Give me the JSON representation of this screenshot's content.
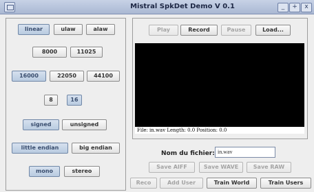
{
  "window": {
    "title": "Mistral SpkDet Demo V 0.1",
    "minimize": "_",
    "maximize": "+",
    "close": "x"
  },
  "options": {
    "encoding": [
      "linear",
      "ulaw",
      "alaw"
    ],
    "rate_a": [
      "8000",
      "11025"
    ],
    "rate_b": [
      "16000",
      "22050",
      "44100"
    ],
    "bits": [
      "8",
      "16"
    ],
    "sign": [
      "signed",
      "unsigned"
    ],
    "endian": [
      "little endian",
      "big endian"
    ],
    "channels": [
      "mono",
      "stereo"
    ]
  },
  "player": {
    "play": "Play",
    "record": "Record",
    "pause": "Pause",
    "load": "Load...",
    "status": "File: in.wav  Length: 0.0  Position: 0.0"
  },
  "filename": {
    "label": "Nom du fichier:",
    "value": "in.wav"
  },
  "save": {
    "aiff": "Save AIFF",
    "wave": "Save WAVE",
    "raw": "Save RAW"
  },
  "actions": {
    "reco": "Reco",
    "add_user": "Add User",
    "train_world": "Train World",
    "train_users": "Train Users"
  }
}
